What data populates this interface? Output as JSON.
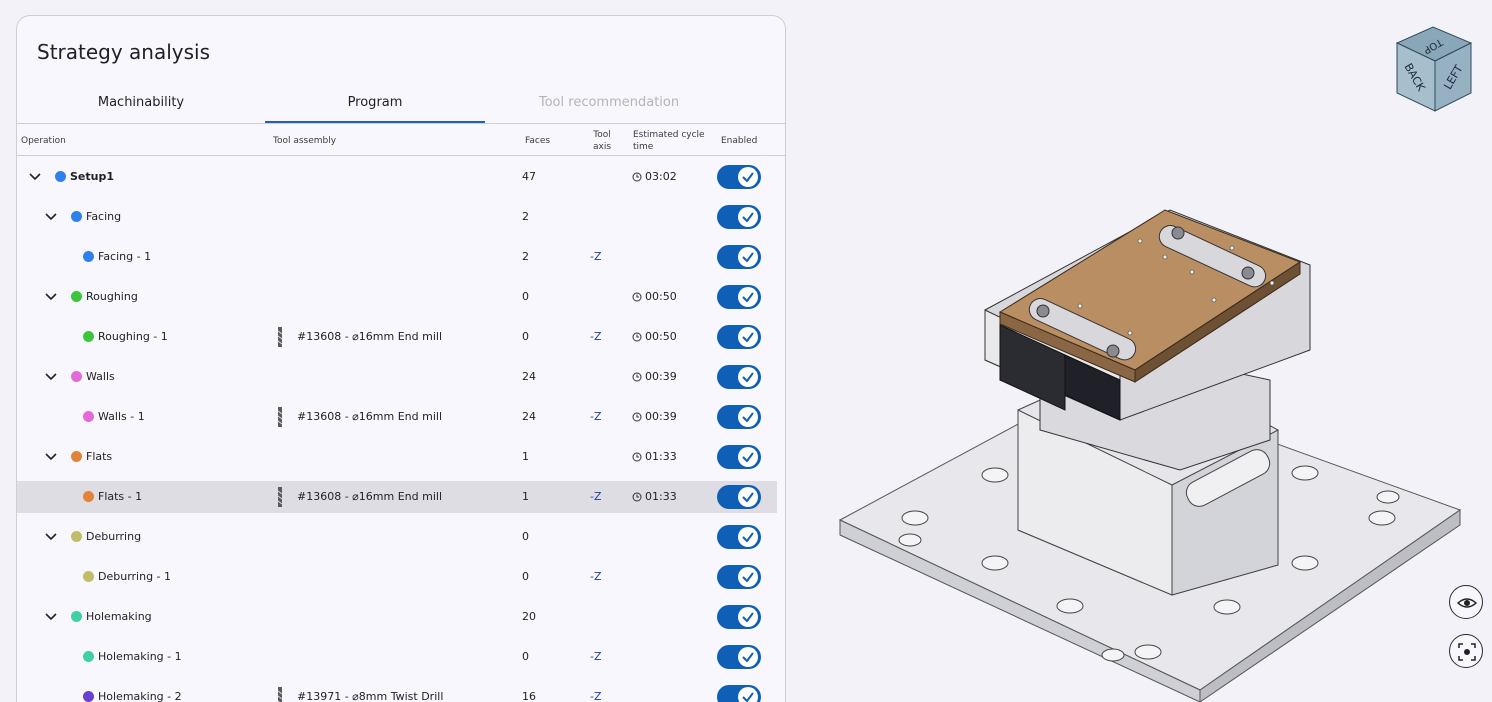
{
  "panel": {
    "title": "Strategy analysis",
    "tabs": [
      {
        "label": "Machinability",
        "state": "normal"
      },
      {
        "label": "Program",
        "state": "active"
      },
      {
        "label": "Tool recommendation",
        "state": "disabled"
      }
    ]
  },
  "table": {
    "headers": {
      "operation": "Operation",
      "tool_assembly": "Tool assembly",
      "faces": "Faces",
      "tool_axis_1": "Tool",
      "tool_axis_2": "axis",
      "cycle_1": "Estimated cycle",
      "cycle_2": "time",
      "enabled": "Enabled"
    },
    "rows": [
      {
        "name": "Setup1",
        "level": 0,
        "expandable": true,
        "color": "#2f80ed",
        "tool": "",
        "faces": "47",
        "axis": "",
        "time": "03:02",
        "enabled": true,
        "selected": false
      },
      {
        "name": "Facing",
        "level": 1,
        "expandable": true,
        "color": "#2f80ed",
        "tool": "",
        "faces": "2",
        "axis": "",
        "time": "",
        "enabled": true,
        "selected": false
      },
      {
        "name": "Facing - 1",
        "level": 2,
        "expandable": false,
        "color": "#2f80ed",
        "tool": "",
        "faces": "2",
        "axis": "-Z",
        "time": "",
        "enabled": true,
        "selected": false
      },
      {
        "name": "Roughing",
        "level": 1,
        "expandable": true,
        "color": "#3dc63d",
        "tool": "",
        "faces": "0",
        "axis": "",
        "time": "00:50",
        "enabled": true,
        "selected": false
      },
      {
        "name": "Roughing - 1",
        "level": 2,
        "expandable": false,
        "color": "#3dc63d",
        "tool": "#13608 - ⌀16mm  End mill",
        "faces": "0",
        "axis": "-Z",
        "time": "00:50",
        "enabled": true,
        "selected": false
      },
      {
        "name": "Walls",
        "level": 1,
        "expandable": true,
        "color": "#e46ad8",
        "tool": "",
        "faces": "24",
        "axis": "",
        "time": "00:39",
        "enabled": true,
        "selected": false
      },
      {
        "name": "Walls - 1",
        "level": 2,
        "expandable": false,
        "color": "#e46ad8",
        "tool": "#13608 - ⌀16mm  End mill",
        "faces": "24",
        "axis": "-Z",
        "time": "00:39",
        "enabled": true,
        "selected": false
      },
      {
        "name": "Flats",
        "level": 1,
        "expandable": true,
        "color": "#e0843a",
        "tool": "",
        "faces": "1",
        "axis": "",
        "time": "01:33",
        "enabled": true,
        "selected": false
      },
      {
        "name": "Flats - 1",
        "level": 2,
        "expandable": false,
        "color": "#e0843a",
        "tool": "#13608 - ⌀16mm  End mill",
        "faces": "1",
        "axis": "-Z",
        "time": "01:33",
        "enabled": true,
        "selected": true
      },
      {
        "name": "Deburring",
        "level": 1,
        "expandable": true,
        "color": "#bfbe66",
        "tool": "",
        "faces": "0",
        "axis": "",
        "time": "",
        "enabled": true,
        "selected": false
      },
      {
        "name": "Deburring - 1",
        "level": 2,
        "expandable": false,
        "color": "#bfbe66",
        "tool": "",
        "faces": "0",
        "axis": "-Z",
        "time": "",
        "enabled": true,
        "selected": false
      },
      {
        "name": "Holemaking",
        "level": 1,
        "expandable": true,
        "color": "#3fd0a6",
        "tool": "",
        "faces": "20",
        "axis": "",
        "time": "",
        "enabled": true,
        "selected": false
      },
      {
        "name": "Holemaking - 1",
        "level": 2,
        "expandable": false,
        "color": "#3fd0a6",
        "tool": "",
        "faces": "0",
        "axis": "-Z",
        "time": "",
        "enabled": true,
        "selected": false
      },
      {
        "name": "Holemaking - 2",
        "level": 2,
        "expandable": false,
        "color": "#6a3fd0",
        "tool": "#13971 - ⌀8mm  Twist Drill",
        "faces": "16",
        "axis": "-Z",
        "time": "",
        "enabled": true,
        "selected": false
      }
    ]
  },
  "viewer": {
    "view_cube": {
      "top": "TOP",
      "front": "BACK",
      "right": "LEFT"
    },
    "buttons": [
      {
        "icon": "eye-icon"
      },
      {
        "icon": "focus-icon"
      }
    ]
  }
}
